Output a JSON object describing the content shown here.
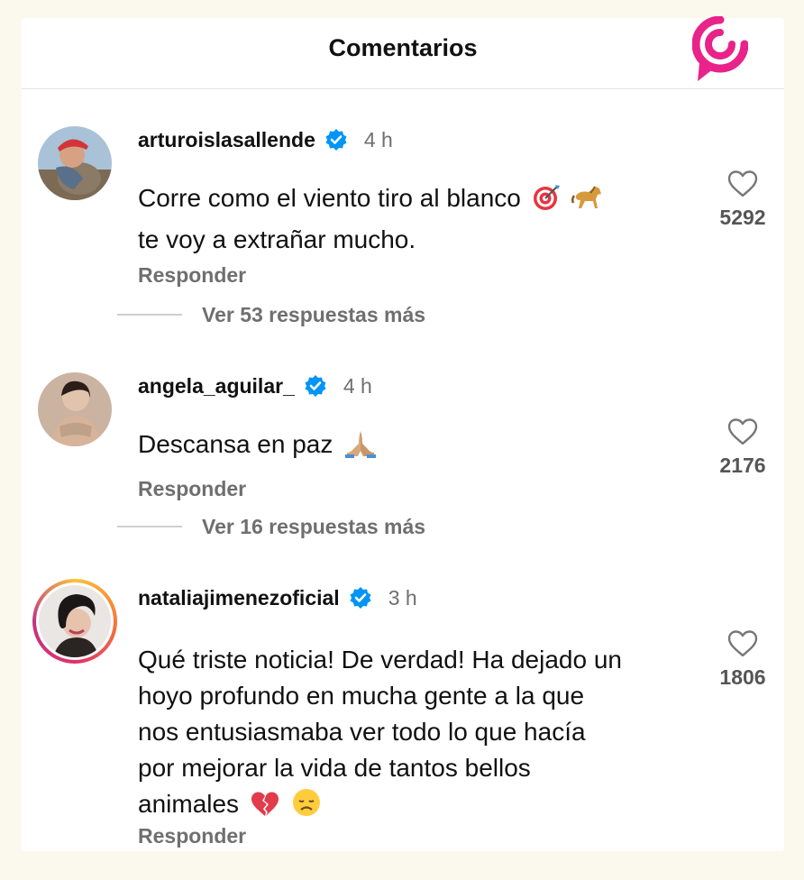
{
  "header": {
    "title": "Comentarios"
  },
  "comments": [
    {
      "username": "arturoislasallende",
      "time": "4 h",
      "text_line1": "Corre como el viento tiro al blanco",
      "text_line2": "te voy a extrañar mucho.",
      "reply": "Responder",
      "likes": "5292",
      "more_replies": "Ver 53 respuestas más",
      "emojis": [
        "target-emoji",
        "horse-emoji"
      ]
    },
    {
      "username": "angela_aguilar_",
      "time": "4 h",
      "text_line1": "Descansa en paz",
      "reply": "Responder",
      "likes": "2176",
      "more_replies": "Ver 16 respuestas más",
      "emojis": [
        "praying-hands-emoji"
      ]
    },
    {
      "username": "nataliajimenezoficial",
      "time": "3 h",
      "text_lines": [
        "Qué triste noticia! De verdad! Ha dejado un",
        "hoyo profundo en mucha gente a la que",
        "nos entusiasmaba ver todo lo que hacía",
        "por mejorar la vida de tantos bellos",
        "animales"
      ],
      "reply": "Responder",
      "likes": "1806",
      "emojis": [
        "broken-heart-emoji",
        "disappointed-face-emoji"
      ]
    }
  ],
  "colors": {
    "verified": "#0095f6",
    "brand": "#e8238a",
    "muted": "#6f6f6f"
  }
}
